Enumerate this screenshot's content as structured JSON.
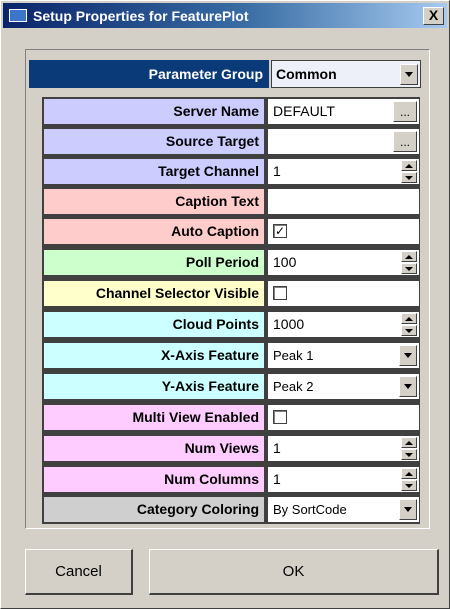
{
  "window": {
    "title": "Setup Properties for FeaturePlot",
    "close_glyph": "X"
  },
  "parameter_group": {
    "label": "Parameter Group",
    "value": "Common"
  },
  "properties": [
    {
      "label": "Server Name",
      "value": "DEFAULT",
      "control": "text-ellipsis",
      "color": "#ccccff"
    },
    {
      "label": "Source Target",
      "value": "",
      "control": "text-ellipsis",
      "color": "#ccccff"
    },
    {
      "label": "Target Channel",
      "value": "1",
      "control": "spinner",
      "color": "#ccccff"
    },
    {
      "label": "Caption Text",
      "value": "",
      "control": "text",
      "color": "#ffcccc"
    },
    {
      "label": "Auto Caption",
      "value": "✓",
      "control": "checkbox",
      "checked": true,
      "color": "#ffcccc"
    },
    {
      "label": "Poll Period",
      "value": "100",
      "control": "spinner",
      "color": "#ccffcc"
    },
    {
      "label": "Channel Selector Visible",
      "value": "",
      "control": "checkbox",
      "checked": false,
      "color": "#ffffcc"
    },
    {
      "label": "Cloud Points",
      "value": "1000",
      "control": "spinner",
      "color": "#ccffff"
    },
    {
      "label": "X-Axis Feature",
      "value": "Peak 1",
      "control": "dropdown",
      "color": "#ccffff"
    },
    {
      "label": "Y-Axis Feature",
      "value": "Peak 2",
      "control": "dropdown",
      "color": "#ccffff"
    },
    {
      "label": "Multi View Enabled",
      "value": "",
      "control": "checkbox",
      "checked": false,
      "color": "#ffccff"
    },
    {
      "label": "Num Views",
      "value": "1",
      "control": "spinner",
      "color": "#ffccff"
    },
    {
      "label": "Num Columns",
      "value": "1",
      "control": "spinner",
      "color": "#ffccff"
    },
    {
      "label": "Category Coloring",
      "value": "By SortCode",
      "control": "dropdown",
      "color": "#cfcfcf"
    }
  ],
  "buttons": {
    "ellipsis": "...",
    "cancel": "Cancel",
    "ok": "OK"
  },
  "colors": {
    "title_start": "#0a246a",
    "title_end": "#a6caf0",
    "group_label_bg": "#0a3a77",
    "dialog_bg": "#d4d0c8"
  }
}
